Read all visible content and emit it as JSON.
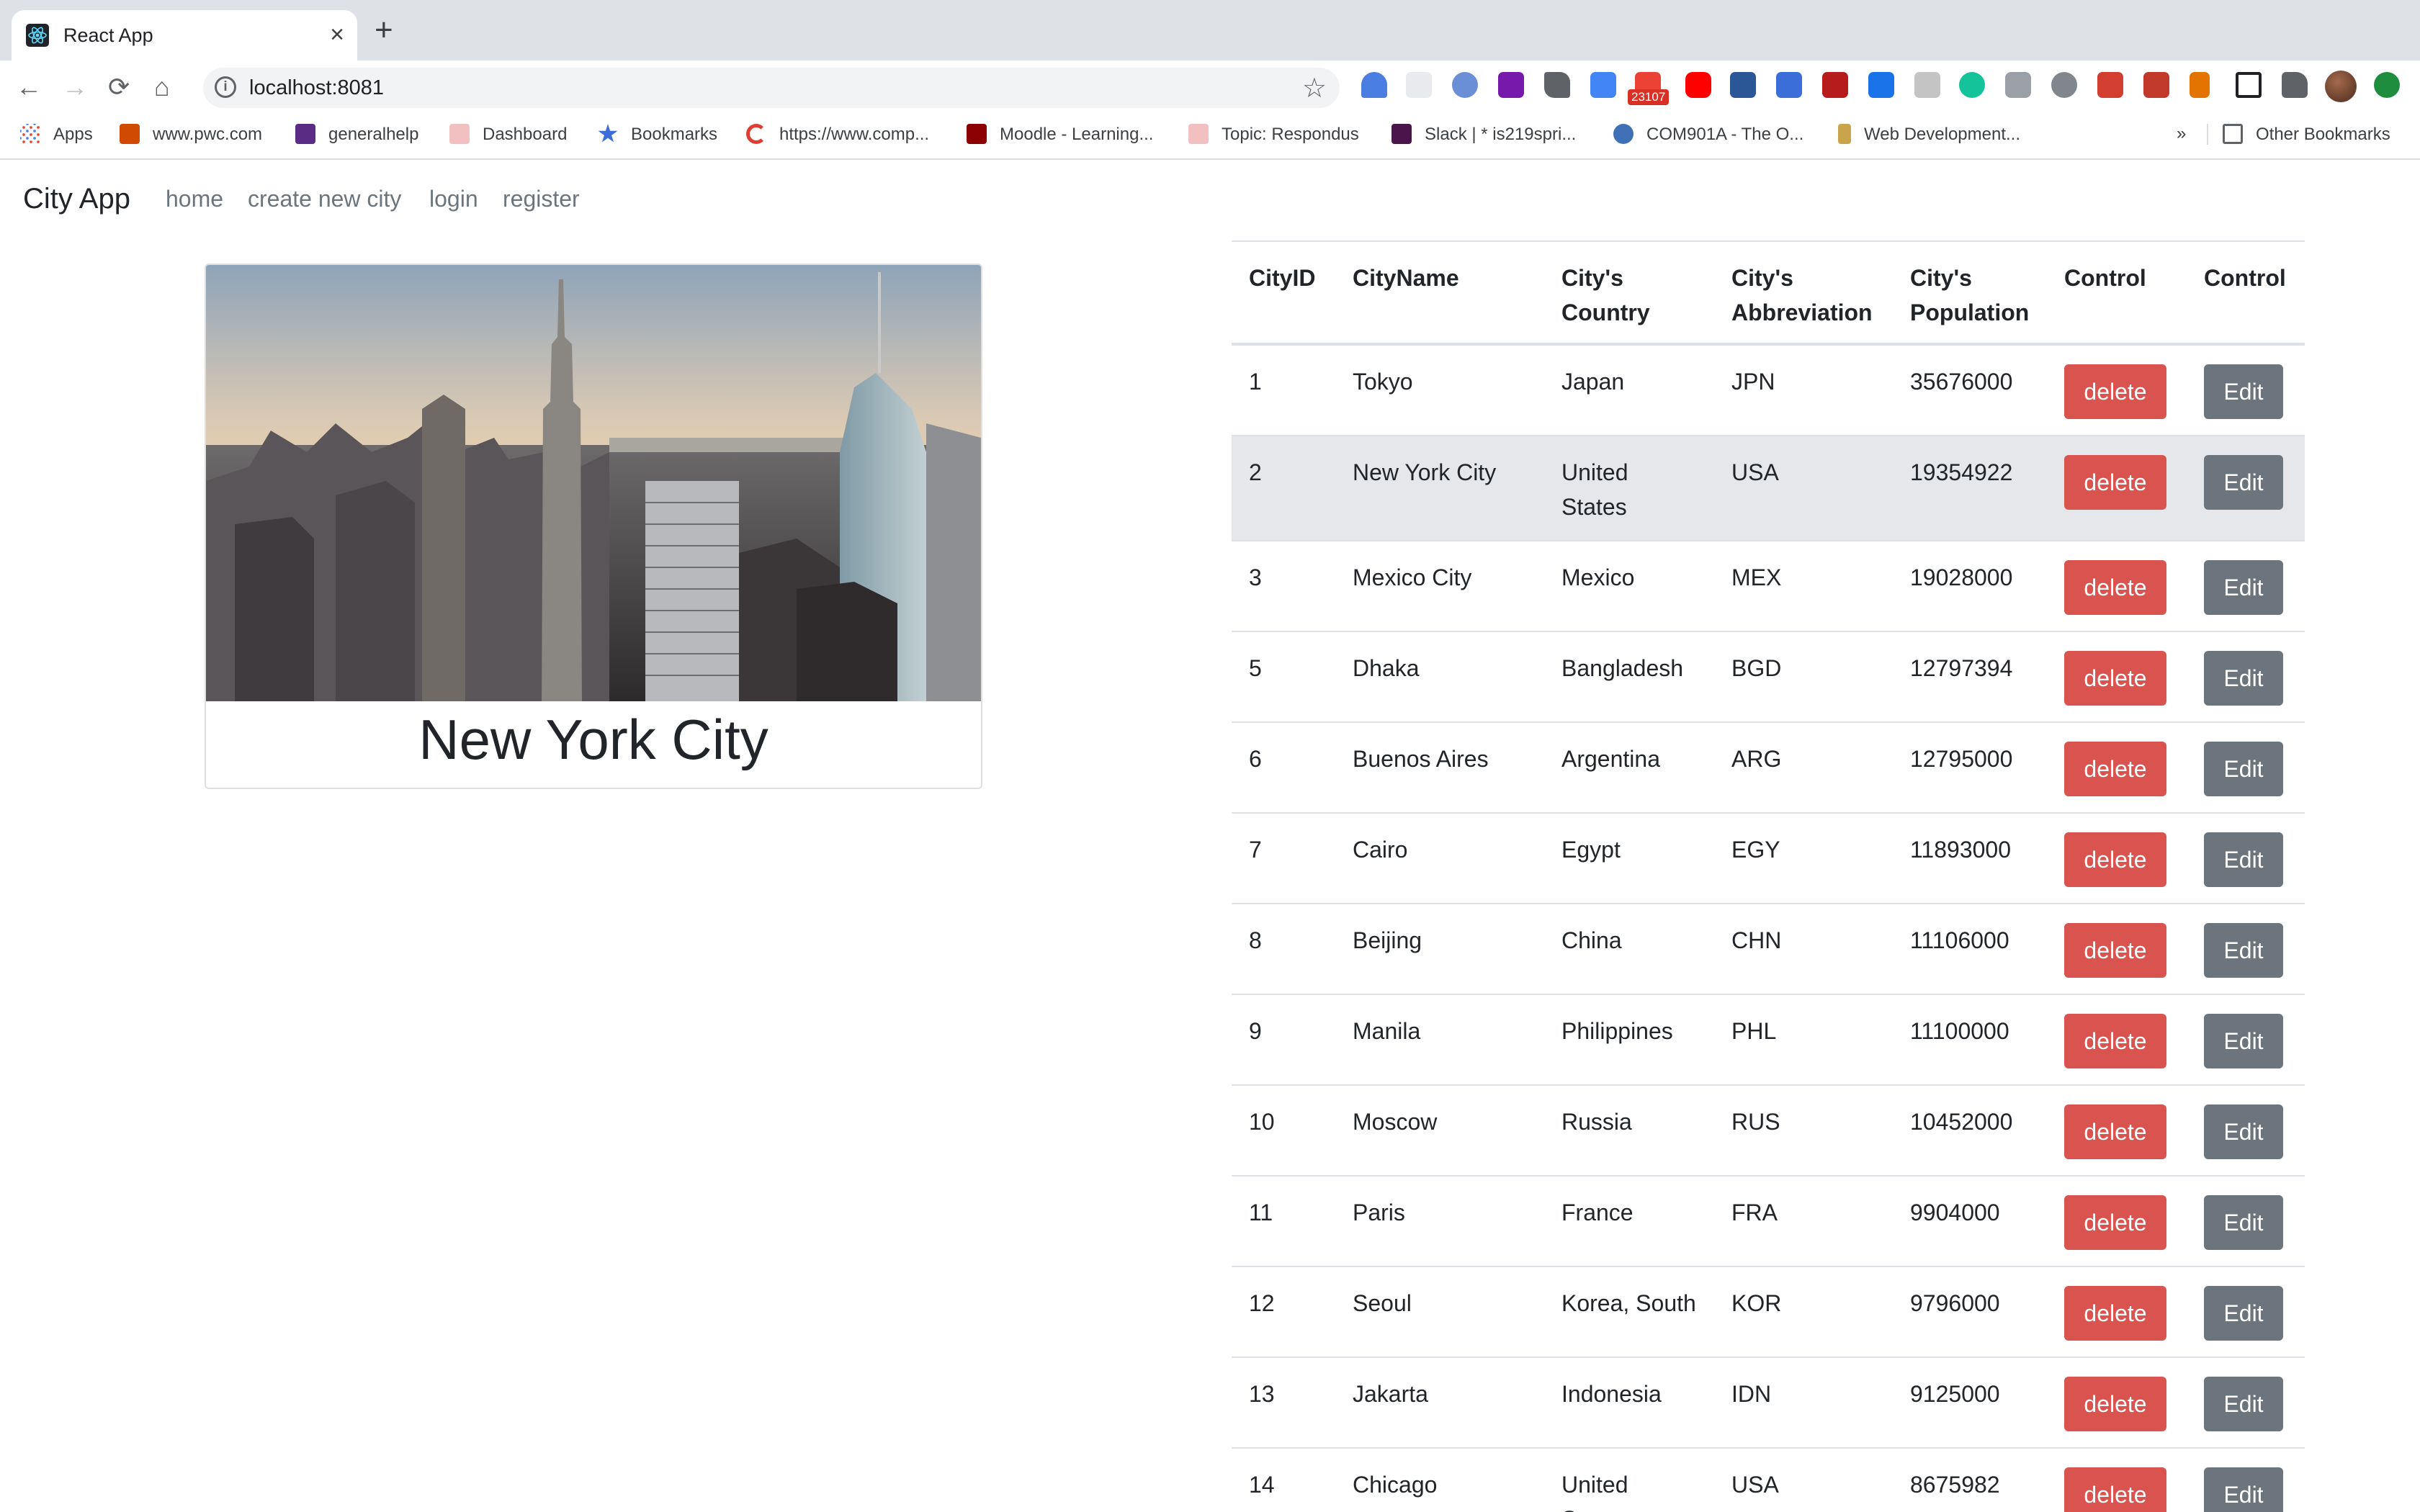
{
  "browser": {
    "tab_title": "React App",
    "tab_close": "×",
    "new_tab": "+",
    "url": "localhost:8081",
    "ext_badge": "23107",
    "bookmarks": [
      {
        "label": "Apps",
        "icon_color": "#4285f4"
      },
      {
        "label": "www.pwc.com",
        "icon_color": "#d04a02"
      },
      {
        "label": "generalhelp",
        "icon_color": "#5b2c83"
      },
      {
        "label": "Dashboard",
        "icon_color": "#c8102e"
      },
      {
        "label": "Bookmarks",
        "icon_color": "#3b6ed9"
      },
      {
        "label": "https://www.comp...",
        "icon_color": "#e03c31"
      },
      {
        "label": "Moodle - Learning...",
        "icon_color": "#8b0000"
      },
      {
        "label": "Topic: Respondus",
        "icon_color": "#c8102e"
      },
      {
        "label": "Slack | * is219spri...",
        "icon_color": "#4a154b"
      },
      {
        "label": "COM901A - The O...",
        "icon_color": "#3f6fb5"
      },
      {
        "label": "Web Development...",
        "icon_color": "#caa44a"
      }
    ],
    "bookmarks_overflow": "»",
    "other_bookmarks": "Other Bookmarks"
  },
  "app": {
    "brand": "City App",
    "nav": [
      "home",
      "create new city",
      "login",
      "register"
    ]
  },
  "card": {
    "title": "New York City",
    "image_alt": "New York City skyline"
  },
  "table": {
    "headers": [
      [
        "CityID"
      ],
      [
        "CityName"
      ],
      [
        "City's",
        "Country"
      ],
      [
        "City's",
        "Abbreviation"
      ],
      [
        "City's",
        "Population"
      ],
      [
        "Control"
      ],
      [
        "Control"
      ]
    ],
    "delete_label": "delete",
    "edit_label": "Edit",
    "rows": [
      {
        "id": "1",
        "name": "Tokyo",
        "country": [
          "Japan"
        ],
        "abbr": "JPN",
        "population": "35676000"
      },
      {
        "id": "2",
        "name": "New York City",
        "country": [
          "United",
          "States"
        ],
        "abbr": "USA",
        "population": "19354922"
      },
      {
        "id": "3",
        "name": "Mexico City",
        "country": [
          "Mexico"
        ],
        "abbr": "MEX",
        "population": "19028000"
      },
      {
        "id": "5",
        "name": "Dhaka",
        "country": [
          "Bangladesh"
        ],
        "abbr": "BGD",
        "population": "12797394"
      },
      {
        "id": "6",
        "name": "Buenos Aires",
        "country": [
          "Argentina"
        ],
        "abbr": "ARG",
        "population": "12795000"
      },
      {
        "id": "7",
        "name": "Cairo",
        "country": [
          "Egypt"
        ],
        "abbr": "EGY",
        "population": "11893000"
      },
      {
        "id": "8",
        "name": "Beijing",
        "country": [
          "China"
        ],
        "abbr": "CHN",
        "population": "11106000"
      },
      {
        "id": "9",
        "name": "Manila",
        "country": [
          "Philippines"
        ],
        "abbr": "PHL",
        "population": "11100000"
      },
      {
        "id": "10",
        "name": "Moscow",
        "country": [
          "Russia"
        ],
        "abbr": "RUS",
        "population": "10452000"
      },
      {
        "id": "11",
        "name": "Paris",
        "country": [
          "France"
        ],
        "abbr": "FRA",
        "population": "9904000"
      },
      {
        "id": "12",
        "name": "Seoul",
        "country": [
          "Korea, South"
        ],
        "abbr": "KOR",
        "population": "9796000"
      },
      {
        "id": "13",
        "name": "Jakarta",
        "country": [
          "Indonesia"
        ],
        "abbr": "IDN",
        "population": "9125000"
      },
      {
        "id": "14",
        "name": "Chicago",
        "country": [
          "United",
          "States"
        ],
        "abbr": "USA",
        "population": "8675982"
      }
    ],
    "highlighted_row": 1
  },
  "colors": {
    "delete": "#d9534f",
    "edit": "#6c757d",
    "stripe": "#e5e7ea"
  }
}
